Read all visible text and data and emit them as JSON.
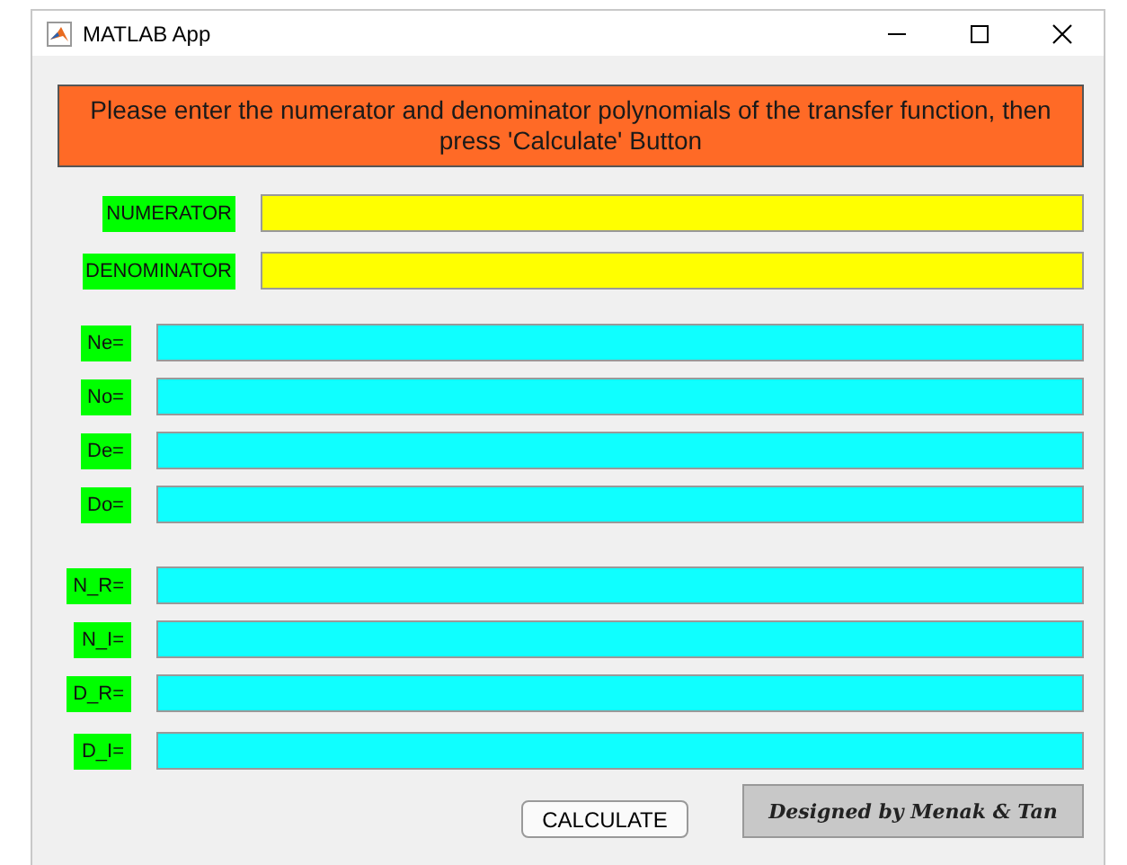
{
  "window": {
    "title": "MATLAB App"
  },
  "banner": "Please enter the numerator and denominator polynomials of the transfer function, then press 'Calculate' Button",
  "groups": [
    {
      "kind": "input",
      "fields": [
        {
          "label": "NUMERATOR"
        },
        {
          "label": "DENOMINATOR"
        }
      ]
    },
    {
      "kind": "output",
      "fields": [
        {
          "label": "Ne="
        },
        {
          "label": "No="
        },
        {
          "label": "De="
        },
        {
          "label": "Do="
        }
      ]
    },
    {
      "kind": "output",
      "fields": [
        {
          "label": "N_R="
        },
        {
          "label": "N_I="
        },
        {
          "label": "D_R="
        },
        {
          "label": "D_I="
        }
      ]
    }
  ],
  "calculate_button": "CALCULATE",
  "credit": "Designed by Menak & Tan"
}
